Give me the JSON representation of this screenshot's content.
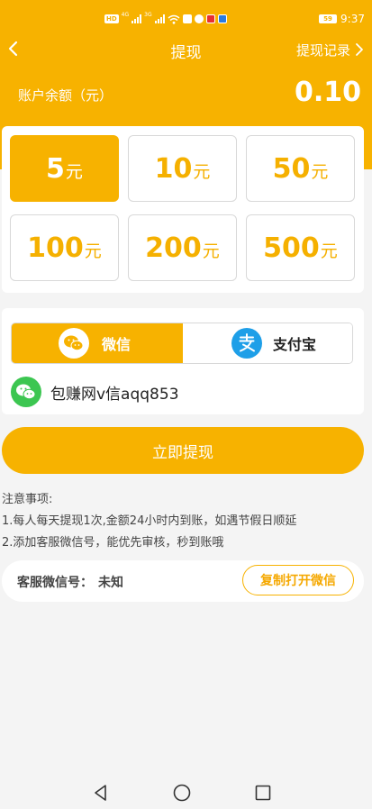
{
  "status_bar": {
    "hd": "HD",
    "net1": "4G",
    "net2": "3G",
    "battery": "59",
    "time": "9:37"
  },
  "nav": {
    "title": "提现",
    "record_link": "提现记录"
  },
  "balance": {
    "label": "账户余额（元）",
    "value": "0.10"
  },
  "amounts": [
    {
      "num": "5",
      "unit": "元",
      "selected": true
    },
    {
      "num": "10",
      "unit": "元",
      "selected": false
    },
    {
      "num": "50",
      "unit": "元",
      "selected": false
    },
    {
      "num": "100",
      "unit": "元",
      "selected": false
    },
    {
      "num": "200",
      "unit": "元",
      "selected": false
    },
    {
      "num": "500",
      "unit": "元",
      "selected": false
    }
  ],
  "payment": {
    "wechat_label": "微信",
    "alipay_label": "支付宝",
    "selected": "wechat",
    "account": "包赚网v信aqq853"
  },
  "submit_label": "立即提现",
  "notice": {
    "title": "注意事项:",
    "line1": "1.每人每天提现1次,金额24小时内到账，如遇节假日顺延",
    "line2": "2.添加客服微信号，能优先审核，秒到账哦"
  },
  "service": {
    "label": "客服微信号：",
    "value": "未知",
    "copy_button": "复制打开微信"
  },
  "colors": {
    "accent": "#f7b200",
    "wechat_green": "#3cc651",
    "alipay_blue": "#1e9fe8",
    "background": "#f4f4f4"
  },
  "icons": [
    "back-icon",
    "chevron-right-icon",
    "wechat-icon",
    "alipay-icon",
    "back-triangle-icon",
    "home-circle-icon",
    "recents-square-icon"
  ]
}
